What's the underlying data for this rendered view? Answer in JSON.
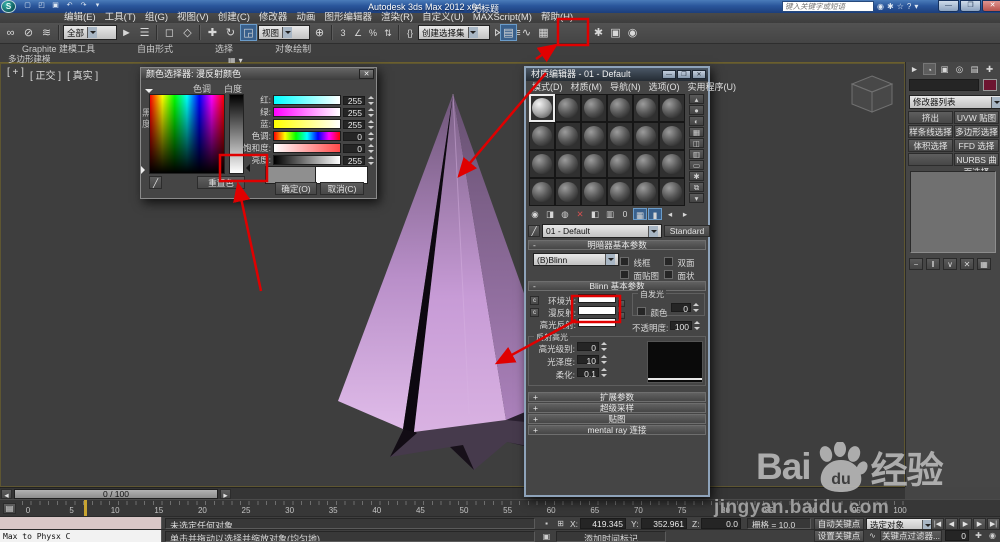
{
  "window": {
    "product": "Autodesk 3ds Max 2012 x64",
    "doc": "无标题",
    "search_placeholder": "键入关键字或短语"
  },
  "menubar": [
    "编辑(E)",
    "工具(T)",
    "组(G)",
    "视图(V)",
    "创建(C)",
    "修改器",
    "动画",
    "图形编辑器",
    "渲染(R)",
    "自定义(U)",
    "MAXScript(M)",
    "帮助(H)"
  ],
  "toolbar": {
    "selection_filter": "全部",
    "coord_system": "视图",
    "named_sets": "创建选择集"
  },
  "ribbon": {
    "tabs": [
      "Graphite 建模工具",
      "自由形式",
      "选择",
      "对象绘制"
    ],
    "subtab": "多边形建模"
  },
  "viewport": {
    "label_plus": "[ + ]",
    "label_view": "[ 正交 ]",
    "label_shading": "[ 真实 ]"
  },
  "color_picker": {
    "title": "颜色选择器: 漫反射颜色",
    "hue": "色调",
    "whiteness": "白度",
    "blackness": "黑度",
    "sliders": [
      {
        "label": "红:",
        "value": "255"
      },
      {
        "label": "绿:",
        "value": "255"
      },
      {
        "label": "蓝:",
        "value": "255"
      },
      {
        "label": "色调:",
        "value": "0"
      },
      {
        "label": "饱和度:",
        "value": "0"
      },
      {
        "label": "亮度:",
        "value": "255"
      }
    ],
    "reset": "重置色",
    "ok": "确定(O)",
    "cancel": "取消(C)"
  },
  "material_editor": {
    "title": "材质编辑器 - 01 - Default",
    "menu": [
      "模式(D)",
      "材质(M)",
      "导航(N)",
      "选项(O)",
      "实用程序(U)"
    ],
    "sample_slot_count": 24,
    "name_combo": "01 - Default",
    "type_button": "Standard",
    "shader_basic": {
      "title": "明暗器基本参数",
      "shader": "(B)Blinn",
      "checks": [
        "线框",
        "双面",
        "面贴图",
        "面状"
      ]
    },
    "blinn_basic": {
      "title": "Blinn 基本参数",
      "ambient": "环境光:",
      "diffuse": "漫反射:",
      "specular": "高光反射:",
      "selfillum": "自发光",
      "color_check": "颜色",
      "selfillum_value": "0",
      "opacity": "不透明度:",
      "opacity_value": "100"
    },
    "specular_highlights": {
      "title": "反射高光",
      "rows": [
        {
          "label": "高光级别:",
          "value": "0"
        },
        {
          "label": "光泽度:",
          "value": "10"
        },
        {
          "label": "柔化:",
          "value": "0.1"
        }
      ]
    },
    "rollouts": [
      "扩展参数",
      "超级采样",
      "贴图",
      "mental ray 连接"
    ]
  },
  "command_panel": {
    "modifier_list": "修改器列表",
    "buttons": [
      "挤出",
      "UVW 贴图",
      "样条线选择",
      "多边形选择",
      "体积选择",
      "FFD 选择",
      "",
      "NURBS 曲面选择"
    ]
  },
  "timeline": {
    "slider": "0 / 100",
    "ticks": [
      "0",
      "5",
      "10",
      "15",
      "20",
      "25",
      "30",
      "35",
      "40",
      "45",
      "50",
      "55",
      "60",
      "65",
      "70",
      "75",
      "80",
      "85",
      "90",
      "95",
      "100"
    ]
  },
  "status": {
    "listener": "Max to Physx C",
    "selection": "未选定任何对象",
    "prompt": "单击并拖动以选择并缩放对象(均匀地)",
    "x_label": "X:",
    "x": "419.345",
    "y_label": "Y:",
    "y": "352.961",
    "z_label": "Z:",
    "z": "0.0",
    "grid": "栅格 = 10.0",
    "add_time_tag": "添加时间标记",
    "auto_key": "自动关键点",
    "set_key": "设置关键点",
    "selection_set": "选定对象",
    "key_filters": "关键点过滤器...",
    "frame": "0"
  },
  "watermark": {
    "bai": "Bai",
    "du": "du",
    "jingyan": "经验",
    "url": "jingyan.baidu.com"
  },
  "colors": {
    "annotation_red": "#e00000",
    "object_purple": "#c79bd6",
    "star_dark": "#463a4c",
    "object_color_swatch": "#6d1430"
  },
  "icons": {
    "app": "S",
    "qnew": "▢",
    "qopen": "◰",
    "qsave": "▣",
    "undo": "↶",
    "redo": "↷",
    "down": "▾",
    "link": "∞",
    "unlink": "⊘",
    "bind": "≋",
    "select": "►",
    "byname": "☰",
    "region": "◻",
    "windowsel": "◇",
    "move": "✚",
    "rotate": "↻",
    "scale": "◲",
    "pivot": "⊕",
    "snap": "∠",
    "percent": "%",
    "spinsnap": "⇅",
    "editsel": "{}",
    "mirror": "⋈",
    "align": "≡",
    "layers": "▤",
    "curve": "∿",
    "schematic": "▦",
    "rendersetup": "✱",
    "renderframe": "▣",
    "render": "◉",
    "search": "◉",
    "wrench": "✱",
    "star": "☆",
    "help": "?",
    "min": "—",
    "max": "❐",
    "close": "✕",
    "dropper": "╱",
    "lock": "▪",
    "absrel": "⊞",
    "keytoggle": "▪",
    "ruler_toggle": "▤",
    "tag": "▣",
    "me_toolbar": [
      "◉",
      "◨",
      "◍",
      "✕",
      "◧",
      "▥",
      "0",
      "▦",
      "▮",
      "◂",
      "▸"
    ],
    "me_side": [
      "▴",
      "●",
      "◐",
      "▦",
      "◫",
      "▥",
      "▭",
      "✱",
      "⧉",
      "▾"
    ],
    "panel_tabs": [
      "►",
      "◔",
      "▣",
      "◎",
      "▤",
      "✚"
    ],
    "stack_icons": [
      "−",
      "‖",
      "∨",
      "✕",
      "▦"
    ],
    "playback": [
      "|◀",
      "◀",
      "▶",
      "▶",
      "▶|"
    ],
    "nav": [
      "✚",
      "◉",
      "⊞",
      "▣"
    ]
  }
}
